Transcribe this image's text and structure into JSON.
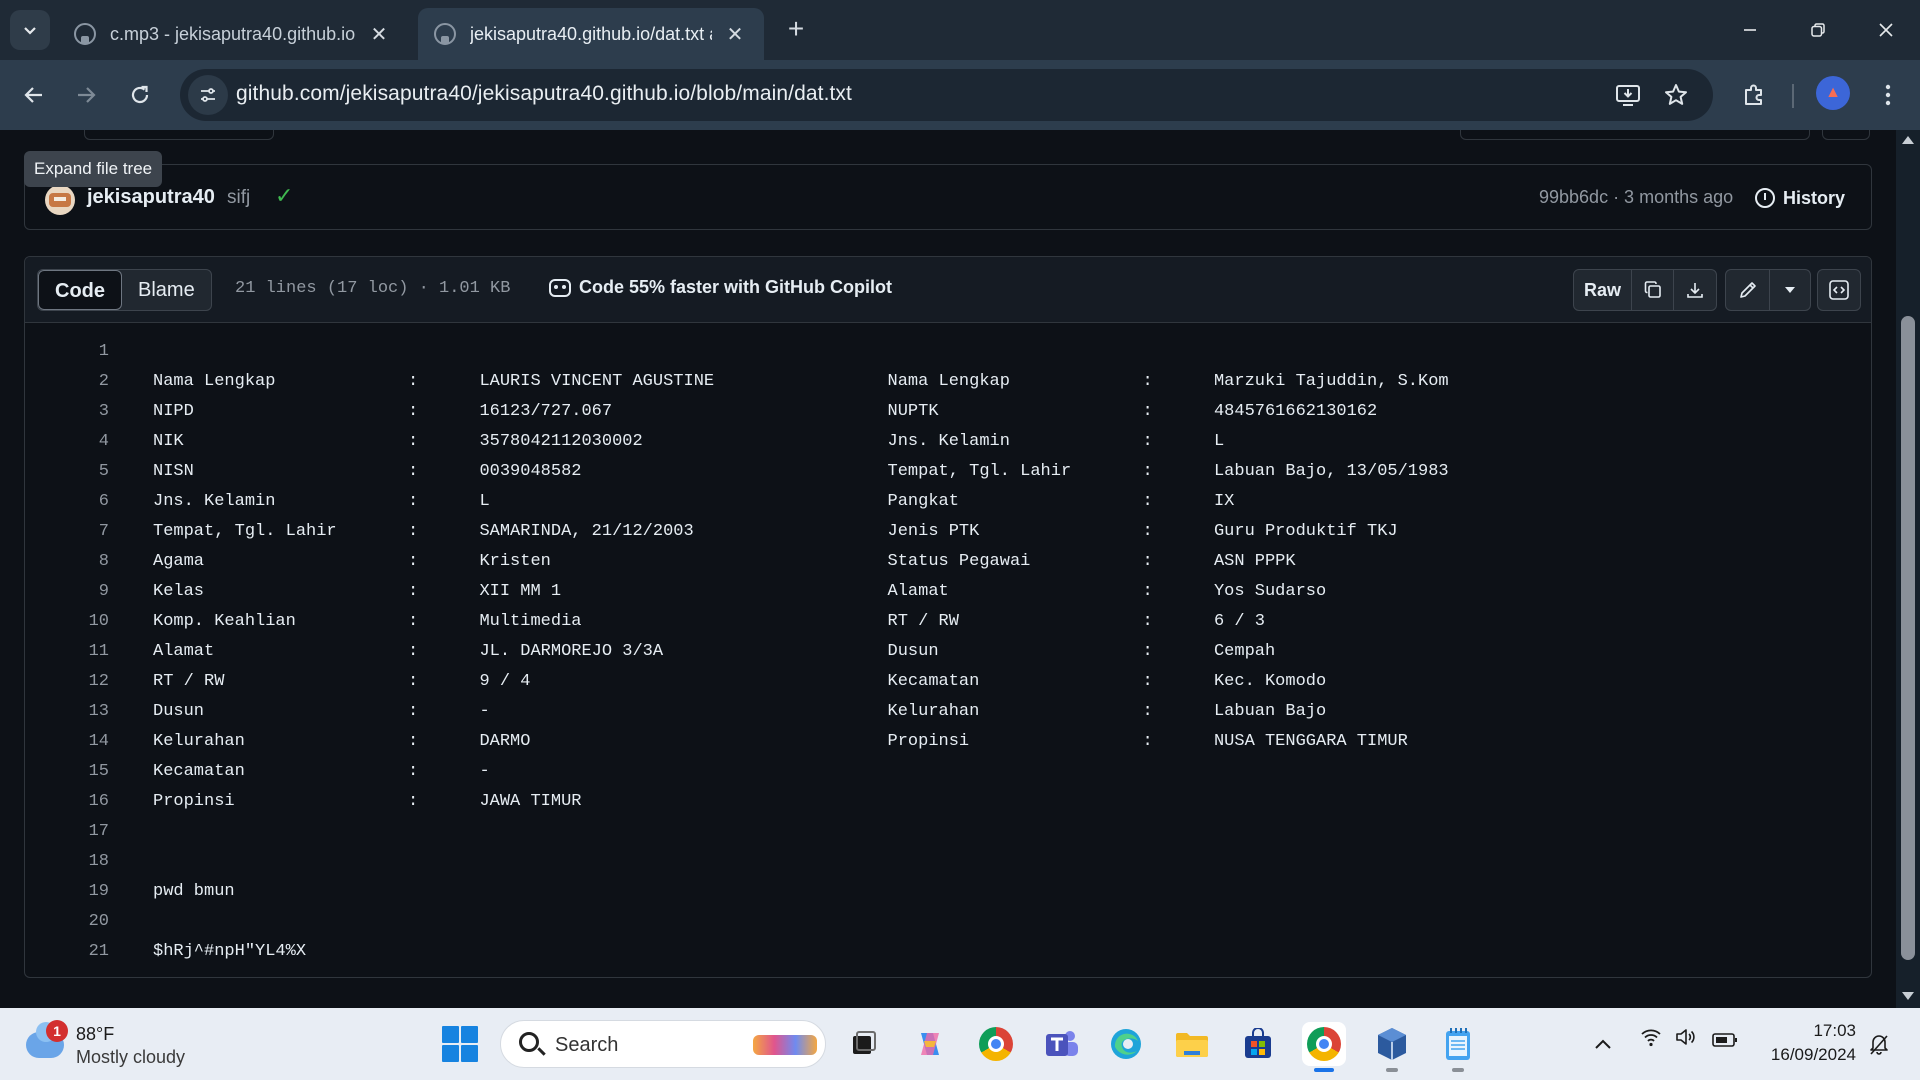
{
  "browser": {
    "tabs": [
      {
        "title": "c.mp3 - jekisaputra40.github.io",
        "active": false
      },
      {
        "title": "jekisaputra40.github.io/dat.txt a",
        "active": true
      }
    ],
    "url": "github.com/jekisaputra40/jekisaputra40.github.io/blob/main/dat.txt"
  },
  "tooltip": "Expand file tree",
  "commit": {
    "author": "jekisaputra40",
    "message": "sifj",
    "meta": "99bb6dc · 3 months ago",
    "history_label": "History"
  },
  "file_header": {
    "tab_code": "Code",
    "tab_blame": "Blame",
    "lines_info": "21 lines (17 loc) · 1.01 KB",
    "copilot": "Code 55% faster with GitHub Copilot",
    "raw_label": "Raw"
  },
  "code_lines": [
    {
      "n": "1",
      "text": ""
    },
    {
      "n": "2",
      "text": "Nama Lengkap             :      LAURIS VINCENT AGUSTINE                 Nama Lengkap             :      Marzuki Tajuddin, S.Kom"
    },
    {
      "n": "3",
      "text": "NIPD                     :      16123/727.067                           NUPTK                    :      4845761662130162"
    },
    {
      "n": "4",
      "text": "NIK                      :      3578042112030002                        Jns. Kelamin             :      L"
    },
    {
      "n": "5",
      "text": "NISN                     :      0039048582                              Tempat, Tgl. Lahir       :      Labuan Bajo, 13/05/1983"
    },
    {
      "n": "6",
      "text": "Jns. Kelamin             :      L                                       Pangkat                  :      IX"
    },
    {
      "n": "7",
      "text": "Tempat, Tgl. Lahir       :      SAMARINDA, 21/12/2003                   Jenis PTK                :      Guru Produktif TKJ"
    },
    {
      "n": "8",
      "text": "Agama                    :      Kristen                                 Status Pegawai           :      ASN PPPK"
    },
    {
      "n": "9",
      "text": "Kelas                    :      XII MM 1                                Alamat                   :      Yos Sudarso"
    },
    {
      "n": "10",
      "text": "Komp. Keahlian           :      Multimedia                              RT / RW                  :      6 / 3"
    },
    {
      "n": "11",
      "text": "Alamat                   :      JL. DARMOREJO 3/3A                      Dusun                    :      Cempah"
    },
    {
      "n": "12",
      "text": "RT / RW                  :      9 / 4                                   Kecamatan                :      Kec. Komodo"
    },
    {
      "n": "13",
      "text": "Dusun                    :      -                                       Kelurahan                :      Labuan Bajo"
    },
    {
      "n": "14",
      "text": "Kelurahan                :      DARMO                                   Propinsi                 :      NUSA TENGGARA TIMUR"
    },
    {
      "n": "15",
      "text": "Kecamatan                :      -"
    },
    {
      "n": "16",
      "text": "Propinsi                 :      JAWA TIMUR"
    },
    {
      "n": "17",
      "text": ""
    },
    {
      "n": "18",
      "text": ""
    },
    {
      "n": "19",
      "text": "pwd bmun"
    },
    {
      "n": "20",
      "text": ""
    },
    {
      "n": "21",
      "text": "$hRj^#npH\"YL4%X"
    }
  ],
  "taskbar": {
    "weather_badge": "1",
    "temp": "88°F",
    "weather_desc": "Mostly cloudy",
    "search_label": "Search",
    "time": "17:03",
    "date": "16/09/2024"
  },
  "colors": {
    "page_bg": "#0d1117",
    "border": "#30363d",
    "success": "#3fb950",
    "chrome_frame": "#1f2a36",
    "chrome_toolbar": "#2d3d4d"
  }
}
